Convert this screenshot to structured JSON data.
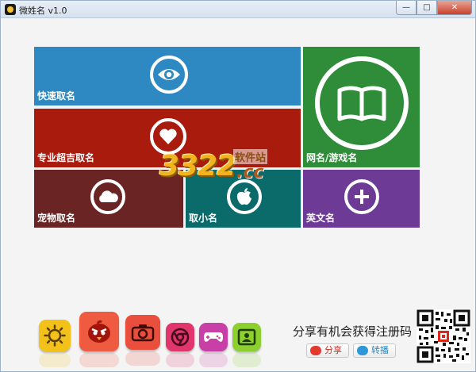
{
  "window": {
    "title": "微姓名 v1.0",
    "minimize_glyph": "—",
    "maximize_glyph": "□",
    "close_glyph": "✕"
  },
  "tiles": {
    "fast_naming": {
      "label": "快速取名",
      "icon": "eye-icon",
      "color": "#2e89c3"
    },
    "pro_naming": {
      "label": "专业超吉取名",
      "icon": "heart-icon",
      "color": "#a81b0d"
    },
    "net_game_name": {
      "label": "网名/游戏名",
      "icon": "book-icon",
      "color": "#2f8d3a"
    },
    "pet_naming": {
      "label": "宠物取名",
      "icon": "cloud-icon",
      "color": "#6a2424"
    },
    "nickname": {
      "label": "取小名",
      "icon": "apple-icon",
      "color": "#0b6b6b"
    },
    "english_name": {
      "label": "英文名",
      "icon": "plus-icon",
      "color": "#6d3b96"
    }
  },
  "watermark": {
    "digits": "3322",
    "site": "软件站",
    "domain": ".cc"
  },
  "app_icons": [
    {
      "name": "sun-app-icon",
      "color": "#f2c21b"
    },
    {
      "name": "angry-bird-app-icon",
      "color": "#ef5b40"
    },
    {
      "name": "camera-app-icon",
      "color": "#ea4e3d"
    },
    {
      "name": "chrome-app-icon",
      "color": "#e0356d"
    },
    {
      "name": "gamepad-app-icon",
      "color": "#c83fa8"
    },
    {
      "name": "contact-card-app-icon",
      "color": "#8ccf2f"
    }
  ],
  "share": {
    "text": "分享有机会获得注册码",
    "weibo_label": "分享",
    "tencent_label": "转播"
  }
}
